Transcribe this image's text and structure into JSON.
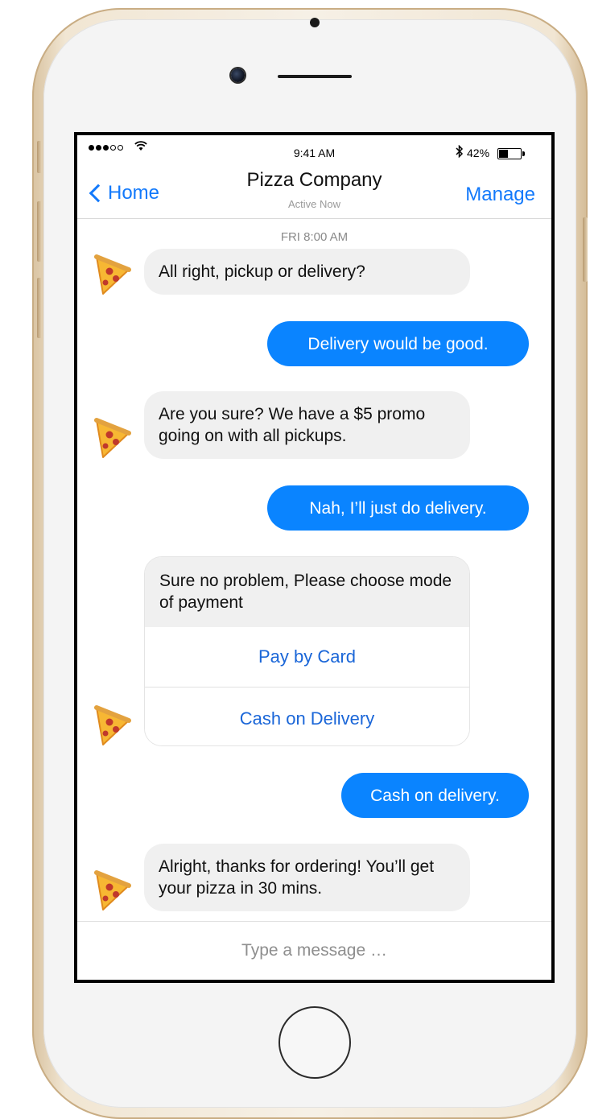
{
  "status_bar": {
    "time": "9:41 AM",
    "battery_percent": "42%",
    "battery_level": 0.42,
    "signal_bars_filled": 3,
    "signal_bars_total": 5
  },
  "nav": {
    "back_label": "Home",
    "title": "Pizza Company",
    "subtitle": "Active Now",
    "manage_label": "Manage"
  },
  "chat": {
    "timestamp": "FRI 8:00 AM",
    "messages": [
      {
        "from": "business",
        "text": "All right, pickup or delivery?"
      },
      {
        "from": "user",
        "text": "Delivery would be good."
      },
      {
        "from": "business",
        "text": "Are you sure? We have a $5 promo going on with all pickups."
      },
      {
        "from": "user",
        "text": "Nah, I’ll just do delivery."
      },
      {
        "from": "business",
        "text": "Sure no problem, Please choose mode of payment"
      },
      {
        "from": "user",
        "text": "Cash on delivery."
      },
      {
        "from": "business",
        "text": "Alright, thanks for ordering! You’ll get your pizza in 30 mins."
      }
    ],
    "payment_options": [
      "Pay by Card",
      "Cash on Delivery"
    ]
  },
  "composer": {
    "placeholder": "Type a message …"
  },
  "colors": {
    "accent": "#1279fb",
    "outgoing_bubble": "#0a84ff",
    "incoming_bubble": "#f0f0f0",
    "phone_gold": "#e8d6b8"
  },
  "icons": {
    "avatar": "pizza-slice-icon",
    "back": "chevron-left-icon",
    "wifi": "wifi-icon",
    "bluetooth": "bluetooth-icon",
    "battery": "battery-icon"
  }
}
